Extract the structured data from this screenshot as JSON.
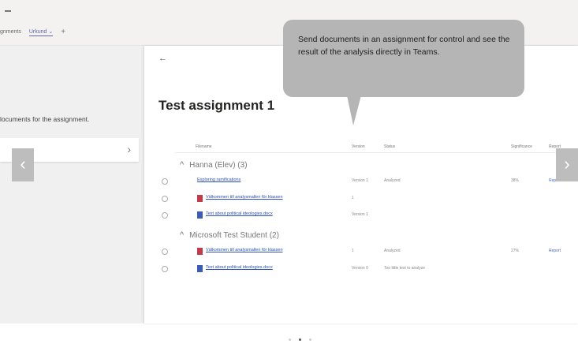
{
  "header": {
    "tabs": [
      {
        "label": "gnments",
        "active": false
      },
      {
        "label": "Urkund ⌄",
        "active": true
      }
    ],
    "add_label": "+"
  },
  "left_pane": {
    "instruction": "locuments for the assignment.",
    "card_chevron": "›"
  },
  "panel": {
    "back_label": "←",
    "title": "Test assignment 1"
  },
  "tooltip": {
    "text": "Send documents in an assignment for control and see the result of the analysis directly in Teams."
  },
  "table": {
    "headers": [
      "Filename",
      "Version",
      "Status",
      "Significance",
      "Report"
    ],
    "groups": [
      {
        "name": "Hanna (Elev) (3)",
        "rows": [
          {
            "icon": "none",
            "filename": "Exploring ramifications",
            "version": "Version 1",
            "status": "Analyzed",
            "significance": "38%",
            "report": "Report"
          },
          {
            "icon": "red-file-icon",
            "filename": "Välkommen till analysmallen för klassen",
            "version": "1",
            "status": "",
            "significance": "",
            "report": ""
          },
          {
            "icon": "word-file-icon",
            "filename": "Text about political ideologies.docx",
            "version": "Version 1",
            "status": "",
            "significance": "",
            "report": ""
          }
        ]
      },
      {
        "name": "Microsoft Test Student (2)",
        "rows": [
          {
            "icon": "red-file-icon",
            "filename": "Välkommen till analysmallen för klassen",
            "version": "1",
            "status": "Analyzed",
            "significance": "27%",
            "report": "Report"
          },
          {
            "icon": "word-file-icon",
            "filename": "Text about political ideologies.docx",
            "version": "Version 0",
            "status": "Too little text to analyze",
            "significance": "",
            "report": ""
          }
        ]
      }
    ]
  },
  "carousel": {
    "prev_label": "‹",
    "next_label": "›",
    "dot_count": 3,
    "active_dot": 2
  }
}
